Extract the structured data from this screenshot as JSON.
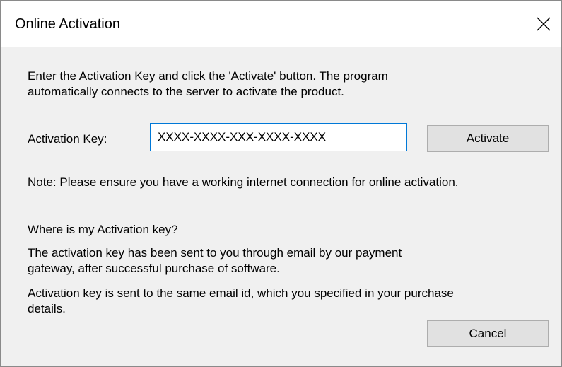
{
  "window": {
    "title": "Online Activation",
    "close_symbol": "close-icon"
  },
  "intro": {
    "line1": "Enter the Activation Key and click the 'Activate' button. The program",
    "line2": "automatically connects to the server to activate the product."
  },
  "activation": {
    "label": "Activation Key:",
    "value": "XXXX-XXXX-XXX-XXXX-XXXX",
    "button_label": "Activate"
  },
  "note": "Note: Please ensure you have a working internet connection for online activation.",
  "help": {
    "heading": "Where is my Activation key?",
    "sent_line1": "The activation key has been sent to you through email by our payment",
    "sent_line2": "gateway, after successful purchase of software.",
    "email_line1": "Activation key is sent to the same email id, which you specified in your purchase",
    "email_line2": "details."
  },
  "footer": {
    "cancel_label": "Cancel"
  },
  "colors": {
    "dialog_background": "#f0f0f0",
    "titlebar_background": "#ffffff",
    "input_border_focus": "#0078d7",
    "button_background": "#e1e1e1",
    "button_border": "#adadad"
  }
}
